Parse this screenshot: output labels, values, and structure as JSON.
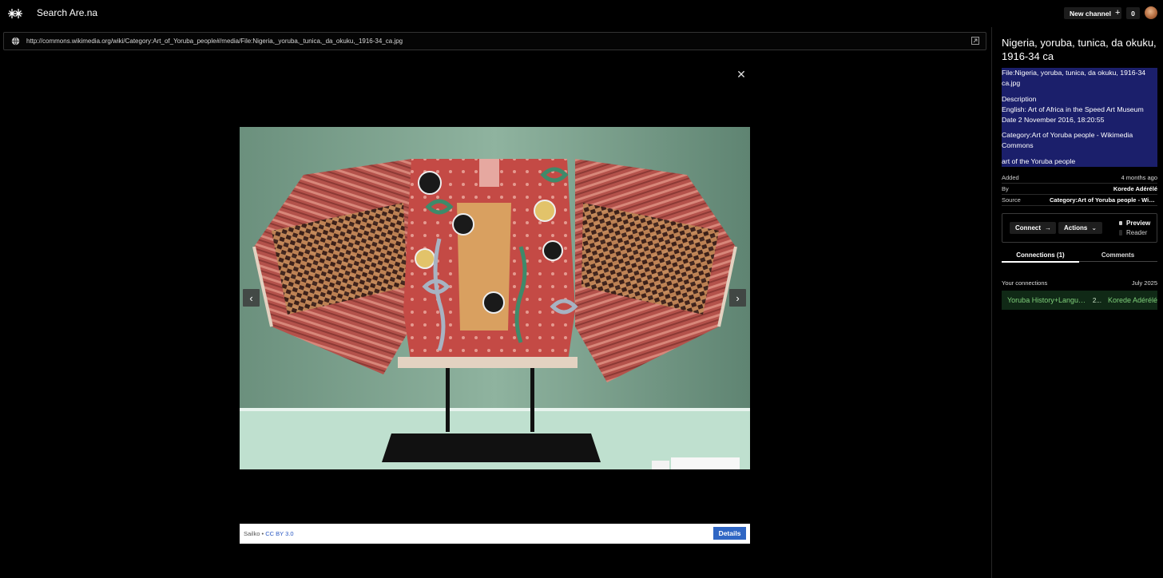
{
  "header": {
    "search_label": "Search Are.na",
    "new_channel_label": "New channel",
    "count": "0"
  },
  "viewer": {
    "url": "http://commons.wikimedia.org/wiki/Category:Art_of_Yoruba_people#/media/File:Nigeria,_yoruba,_tunica,_da_okuku,_1916-34_ca.jpg",
    "credit_author": "Sailko",
    "credit_sep": "•",
    "credit_license": "CC BY 3.0",
    "details_label": "Details"
  },
  "panel": {
    "title": "Nigeria, yoruba, tunica, da okuku, 1916-34 ca",
    "description": [
      "File:Nigeria, yoruba, tunica, da okuku, 1916-34 ca.jpg",
      "Description\nEnglish: Art of Africa in the Speed Art Museum\nDate 2 November 2016, 18:20:55",
      "Category:Art of Yoruba people - Wikimedia Commons",
      "art of the Yoruba people"
    ],
    "meta": {
      "added_label": "Added",
      "added_value": "4 months ago",
      "by_label": "By",
      "by_value": "Korede Adérélé",
      "source_label": "Source",
      "source_value": "Category:Art of Yoruba people - Wikimedia Commons"
    },
    "actions": {
      "connect_label": "Connect",
      "actions_label": "Actions",
      "view_options": [
        "Preview",
        "Reader"
      ]
    },
    "tabs": [
      "Connections (1)",
      "Comments"
    ],
    "your_connections_label": "Your connections",
    "connections_date": "July 2025",
    "connection": {
      "channel": "Yoruba History+Language",
      "count": "2...",
      "user": "Korede Adérélé"
    }
  },
  "colors": {
    "background": "#000000",
    "description_bg": "#1b1f6b",
    "details_button": "#2f66c4",
    "connection_bg": "#102916",
    "connection_text": "#7fd07a"
  }
}
